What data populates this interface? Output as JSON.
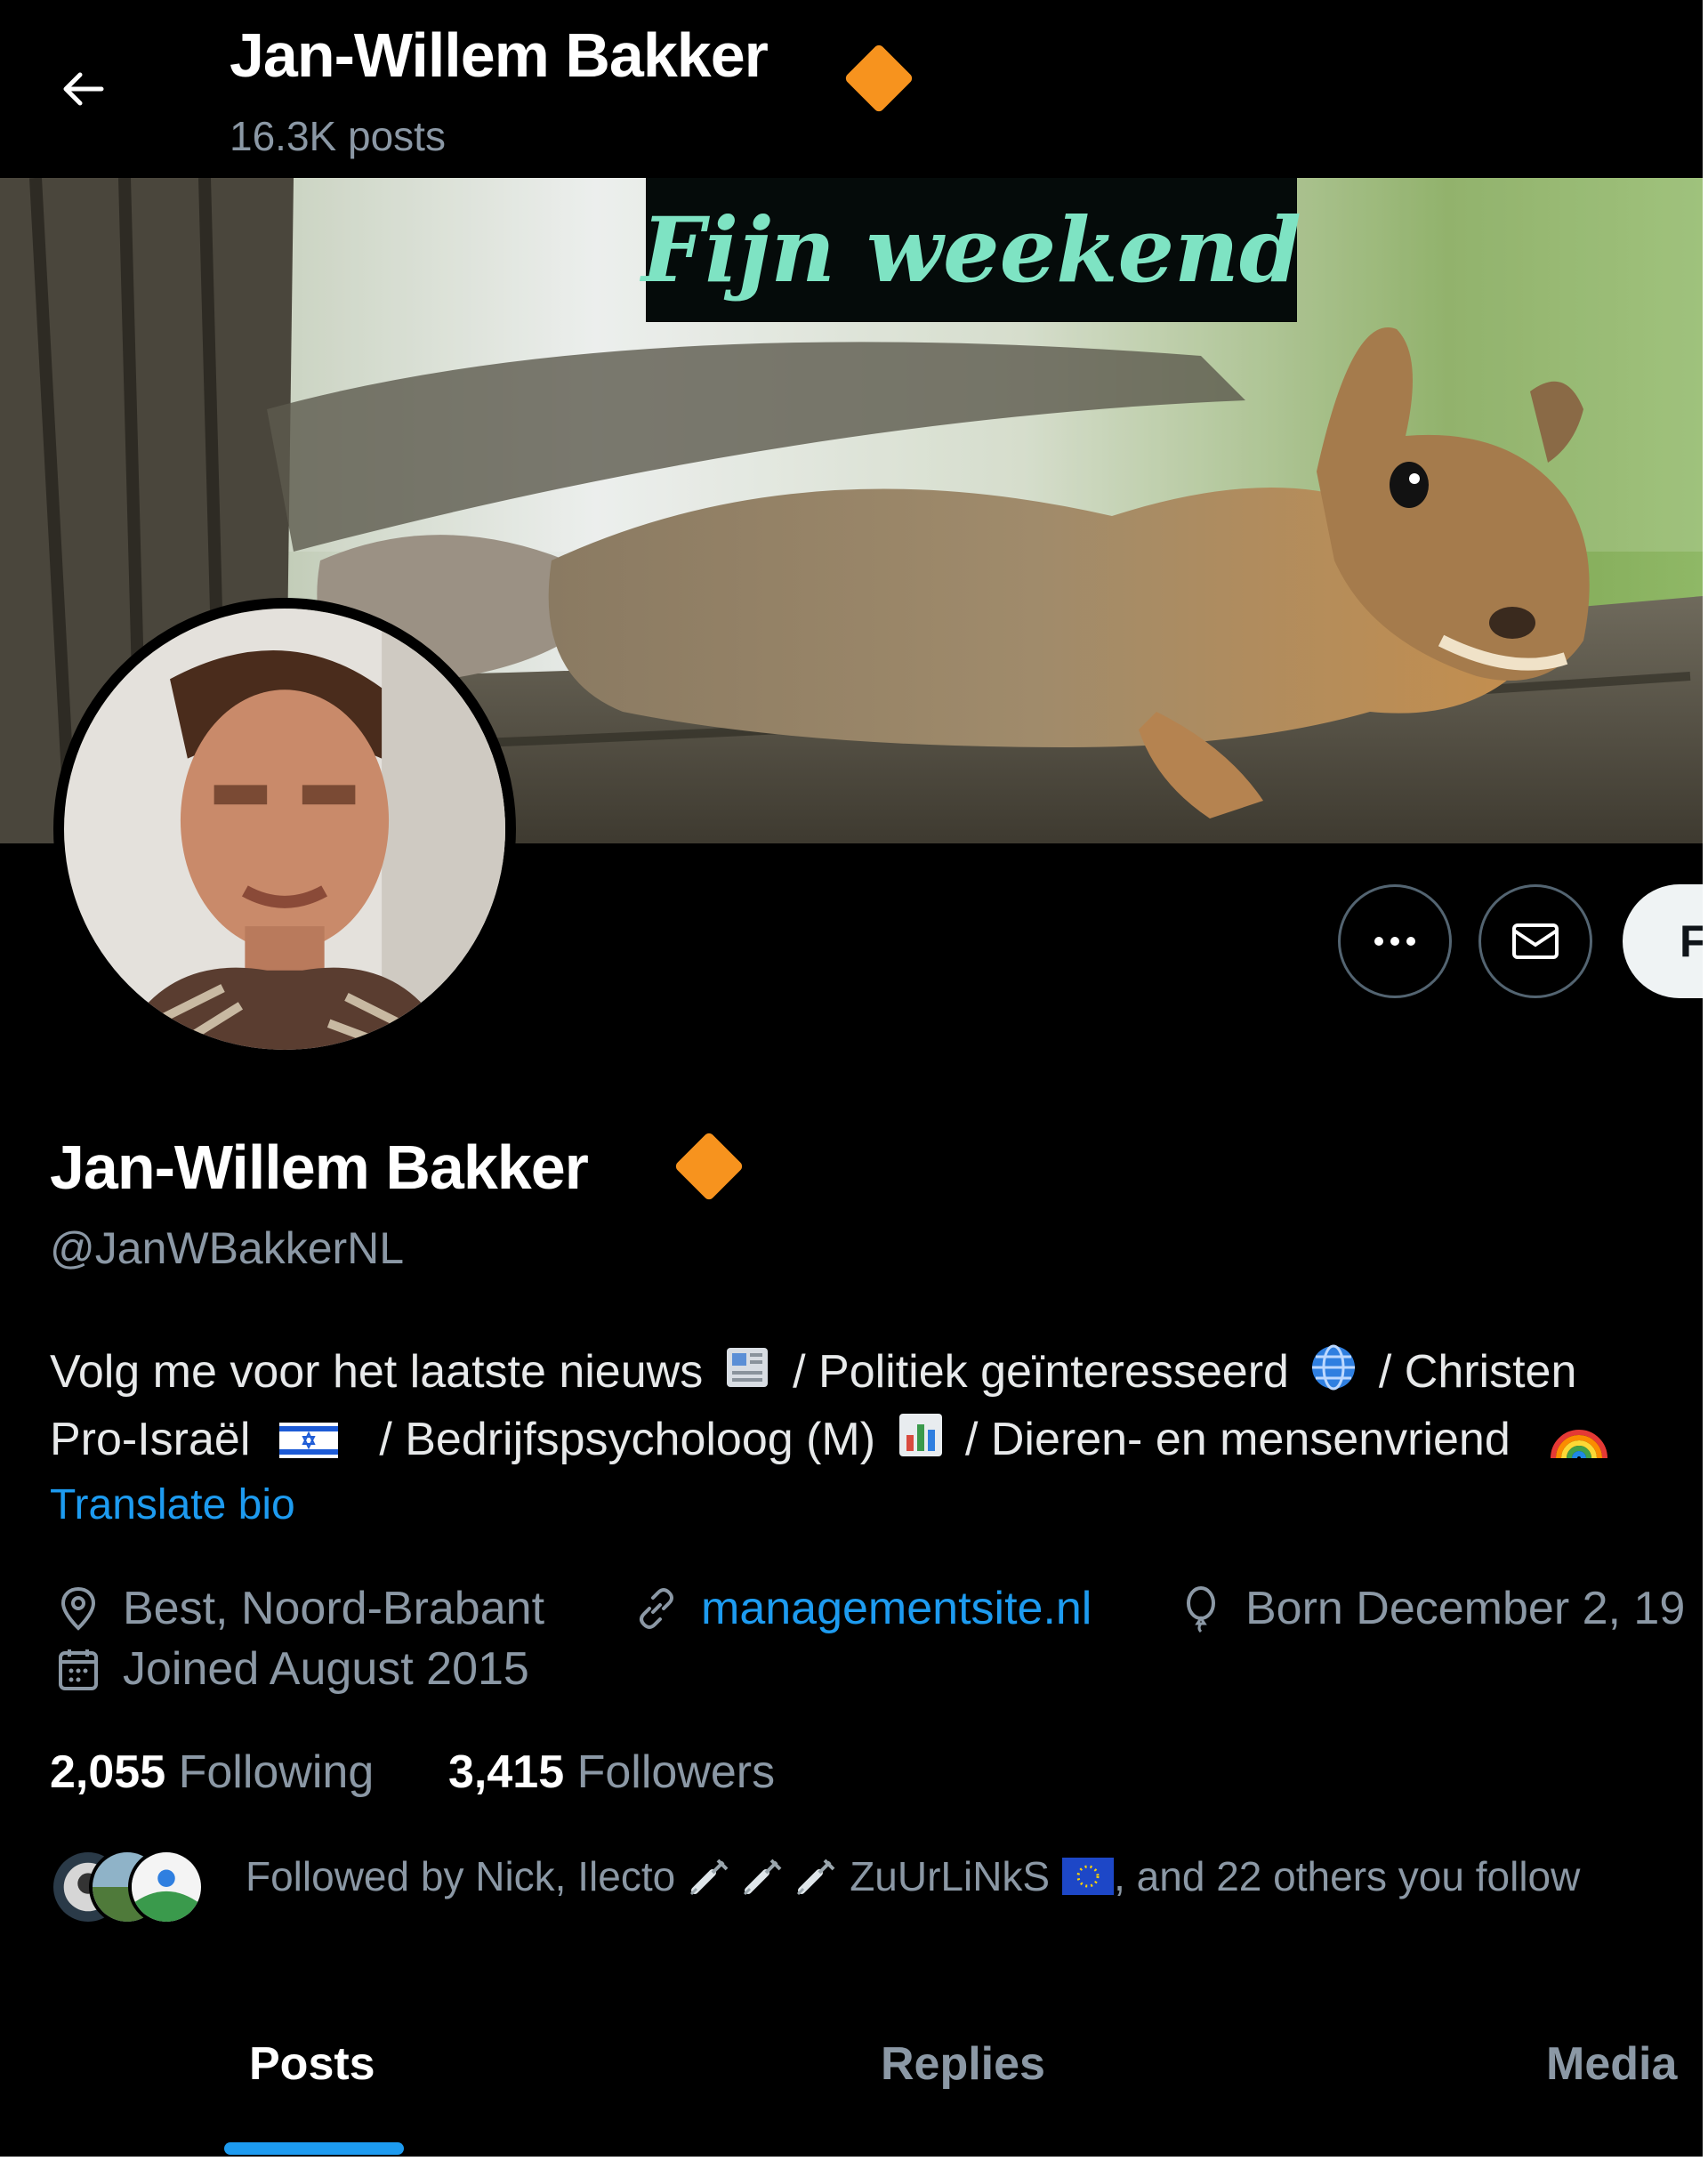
{
  "header": {
    "name": "Jan-Willem Bakker",
    "posts_count": "16.3K posts",
    "back_icon": "arrow-left-icon",
    "badge_color": "#f7931e"
  },
  "banner": {
    "caption": "Fijn weekend",
    "image": "squirrel-on-branch"
  },
  "actions": {
    "more_icon": "more-horizontal-icon",
    "message_icon": "envelope-icon",
    "follow_label": "F"
  },
  "profile": {
    "name": "Jan-Willem Bakker",
    "handle": "@JanWBakkerNL",
    "bio": {
      "line1_a": "Volg me voor het laatste nieuws",
      "line1_b": "/ Politiek geïnteresseerd",
      "line1_c": "/ Christen",
      "line2_a": "Pro-Israël",
      "line2_b": "/ Bedrijfspsycholoog (M)",
      "line2_c": "/ Dieren- en mensenvriend"
    },
    "translate_label": "Translate bio"
  },
  "meta": {
    "location": "Best, Noord-Brabant",
    "website": "managementsite.nl",
    "born": "Born December 2, 19",
    "joined": "Joined August 2015"
  },
  "stats": {
    "following_count": "2,055",
    "following_label": "Following",
    "followers_count": "3,415",
    "followers_label": "Followers"
  },
  "followed_by": {
    "prefix": "Followed by Nick, Ilecto",
    "name2": "ZuUrLiNkS",
    "suffix": ", and 22 others you follow"
  },
  "tabs": [
    {
      "label": "Posts",
      "active": true
    },
    {
      "label": "Replies",
      "active": false
    },
    {
      "label": "Media",
      "active": false
    }
  ],
  "colors": {
    "accent": "#1d9bf0",
    "muted_text": "#8b98a5",
    "verified_badge": "#f7931e"
  }
}
